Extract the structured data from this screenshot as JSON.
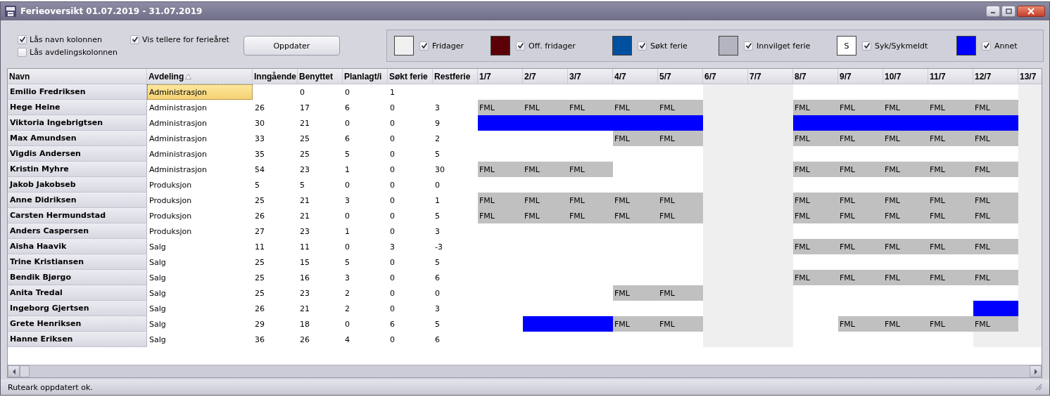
{
  "window": {
    "title": "Ferieoversikt 01.07.2019 - 31.07.2019"
  },
  "options": [
    {
      "label": "Lås navn kolonnen",
      "checked": true
    },
    {
      "label": "Lås avdelingskolonnen",
      "checked": false
    },
    {
      "label": "Vis tellere for ferieåret",
      "checked": true
    }
  ],
  "update_button": "Oppdater",
  "legend": [
    {
      "label": "Fridager",
      "color": "#f0f0f0",
      "checked": true
    },
    {
      "label": "Off. fridager",
      "color": "#5c0008",
      "checked": true
    },
    {
      "label": "Søkt ferie",
      "color": "#0050a0",
      "checked": true
    },
    {
      "label": "Innvilget ferie",
      "color": "#b4b4c0",
      "checked": true
    },
    {
      "label": "Syk/Sykmeldt",
      "color": "#ffffff",
      "swatch_text": "S",
      "checked": true
    },
    {
      "label": "Annet",
      "color": "#0000ff",
      "checked": true
    }
  ],
  "table": {
    "columns": [
      {
        "label": "Navn"
      },
      {
        "label": "Avdeling",
        "sorted": true
      },
      {
        "label": "Inngående"
      },
      {
        "label": "Benyttet"
      },
      {
        "label": "Planlagt/i"
      },
      {
        "label": "Søkt ferie"
      },
      {
        "label": "Restferie"
      }
    ],
    "days": [
      {
        "label": "1/7",
        "weekend": false
      },
      {
        "label": "2/7",
        "weekend": false
      },
      {
        "label": "3/7",
        "weekend": false
      },
      {
        "label": "4/7",
        "weekend": false
      },
      {
        "label": "5/7",
        "weekend": false
      },
      {
        "label": "6/7",
        "weekend": true
      },
      {
        "label": "7/7",
        "weekend": true
      },
      {
        "label": "8/7",
        "weekend": false
      },
      {
        "label": "9/7",
        "weekend": false
      },
      {
        "label": "10/7",
        "weekend": false
      },
      {
        "label": "11/7",
        "weekend": false
      },
      {
        "label": "12/7",
        "weekend": false
      },
      {
        "label": "13/7",
        "weekend": true
      }
    ],
    "rows": [
      {
        "name": "Emilio Fredriksen",
        "department": "Administrasjon",
        "selected": true,
        "used": "0",
        "planned": "0",
        "applied": "1",
        "cells": [
          {
            "kind": "empty"
          },
          {
            "kind": "empty"
          },
          {
            "kind": "empty"
          },
          {
            "kind": "empty"
          },
          {
            "kind": "empty"
          },
          {
            "kind": "empty"
          },
          {
            "kind": "empty"
          },
          {
            "kind": "empty"
          },
          {
            "kind": "empty"
          },
          {
            "kind": "empty"
          },
          {
            "kind": "empty"
          },
          {
            "kind": "empty"
          },
          {
            "kind": "empty"
          }
        ]
      },
      {
        "name": "Hege Heine",
        "department": "Administrasjon",
        "selected": false,
        "incoming": "26",
        "used": "17",
        "planned": "6",
        "applied": "0",
        "remaining": "3",
        "cells": [
          {
            "kind": "fml",
            "text": "FML"
          },
          {
            "kind": "fml",
            "text": "FML"
          },
          {
            "kind": "fml",
            "text": "FML"
          },
          {
            "kind": "fml",
            "text": "FML"
          },
          {
            "kind": "fml",
            "text": "FML"
          },
          {
            "kind": "empty"
          },
          {
            "kind": "empty"
          },
          {
            "kind": "fml",
            "text": "FML"
          },
          {
            "kind": "fml",
            "text": "FML"
          },
          {
            "kind": "fml",
            "text": "FML"
          },
          {
            "kind": "fml",
            "text": "FML"
          },
          {
            "kind": "fml",
            "text": "FML"
          },
          {
            "kind": "empty"
          }
        ]
      },
      {
        "name": "Viktoria Ingebrigtsen",
        "department": "Administrasjon",
        "selected": false,
        "incoming": "30",
        "used": "21",
        "planned": "0",
        "applied": "0",
        "remaining": "9",
        "cells": [
          {
            "kind": "other"
          },
          {
            "kind": "other"
          },
          {
            "kind": "other"
          },
          {
            "kind": "other"
          },
          {
            "kind": "other"
          },
          {
            "kind": "empty"
          },
          {
            "kind": "empty"
          },
          {
            "kind": "other"
          },
          {
            "kind": "other"
          },
          {
            "kind": "other"
          },
          {
            "kind": "other"
          },
          {
            "kind": "other"
          },
          {
            "kind": "empty"
          }
        ]
      },
      {
        "name": "Max Amundsen",
        "department": "Administrasjon",
        "selected": false,
        "incoming": "33",
        "used": "25",
        "planned": "6",
        "applied": "0",
        "remaining": "2",
        "cells": [
          {
            "kind": "empty"
          },
          {
            "kind": "empty"
          },
          {
            "kind": "empty"
          },
          {
            "kind": "fml",
            "text": "FML"
          },
          {
            "kind": "fml",
            "text": "FML"
          },
          {
            "kind": "empty"
          },
          {
            "kind": "empty"
          },
          {
            "kind": "fml",
            "text": "FML"
          },
          {
            "kind": "fml",
            "text": "FML"
          },
          {
            "kind": "fml",
            "text": "FML"
          },
          {
            "kind": "fml",
            "text": "FML"
          },
          {
            "kind": "fml",
            "text": "FML"
          },
          {
            "kind": "empty"
          }
        ]
      },
      {
        "name": "Vigdis Andersen",
        "department": "Administrasjon",
        "selected": false,
        "incoming": "35",
        "used": "25",
        "planned": "5",
        "applied": "0",
        "remaining": "5",
        "cells": [
          {
            "kind": "empty"
          },
          {
            "kind": "empty"
          },
          {
            "kind": "empty"
          },
          {
            "kind": "empty"
          },
          {
            "kind": "empty"
          },
          {
            "kind": "empty"
          },
          {
            "kind": "empty"
          },
          {
            "kind": "empty"
          },
          {
            "kind": "empty"
          },
          {
            "kind": "empty"
          },
          {
            "kind": "empty"
          },
          {
            "kind": "empty"
          },
          {
            "kind": "empty"
          }
        ]
      },
      {
        "name": "Kristin Myhre",
        "department": "Administrasjon",
        "selected": false,
        "incoming": "54",
        "used": "23",
        "planned": "1",
        "applied": "0",
        "remaining": "30",
        "cells": [
          {
            "kind": "fml",
            "text": "FML"
          },
          {
            "kind": "fml",
            "text": "FML"
          },
          {
            "kind": "fml",
            "text": "FML"
          },
          {
            "kind": "empty"
          },
          {
            "kind": "empty"
          },
          {
            "kind": "empty"
          },
          {
            "kind": "empty"
          },
          {
            "kind": "fml",
            "text": "FML"
          },
          {
            "kind": "fml",
            "text": "FML"
          },
          {
            "kind": "fml",
            "text": "FML"
          },
          {
            "kind": "fml",
            "text": "FML"
          },
          {
            "kind": "fml",
            "text": "FML"
          },
          {
            "kind": "empty"
          }
        ]
      },
      {
        "name": "Jakob Jakobseb",
        "department": "Produksjon",
        "selected": false,
        "incoming": "5",
        "used": "5",
        "planned": "0",
        "applied": "0",
        "remaining": "0",
        "cells": [
          {
            "kind": "empty"
          },
          {
            "kind": "empty"
          },
          {
            "kind": "empty"
          },
          {
            "kind": "empty"
          },
          {
            "kind": "empty"
          },
          {
            "kind": "empty"
          },
          {
            "kind": "empty"
          },
          {
            "kind": "empty"
          },
          {
            "kind": "empty"
          },
          {
            "kind": "empty"
          },
          {
            "kind": "empty"
          },
          {
            "kind": "empty"
          },
          {
            "kind": "empty"
          }
        ]
      },
      {
        "name": "Anne Didriksen",
        "department": "Produksjon",
        "selected": false,
        "incoming": "25",
        "used": "21",
        "planned": "3",
        "applied": "0",
        "remaining": "1",
        "cells": [
          {
            "kind": "fml",
            "text": "FML"
          },
          {
            "kind": "fml",
            "text": "FML"
          },
          {
            "kind": "fml",
            "text": "FML"
          },
          {
            "kind": "fml",
            "text": "FML"
          },
          {
            "kind": "fml",
            "text": "FML"
          },
          {
            "kind": "empty"
          },
          {
            "kind": "empty"
          },
          {
            "kind": "fml",
            "text": "FML"
          },
          {
            "kind": "fml",
            "text": "FML"
          },
          {
            "kind": "fml",
            "text": "FML"
          },
          {
            "kind": "fml",
            "text": "FML"
          },
          {
            "kind": "fml",
            "text": "FML"
          },
          {
            "kind": "empty"
          }
        ]
      },
      {
        "name": "Carsten Hermundstad",
        "department": "Produksjon",
        "selected": false,
        "incoming": "26",
        "used": "21",
        "planned": "0",
        "applied": "0",
        "remaining": "5",
        "cells": [
          {
            "kind": "fml",
            "text": "FML"
          },
          {
            "kind": "fml",
            "text": "FML"
          },
          {
            "kind": "fml",
            "text": "FML"
          },
          {
            "kind": "fml",
            "text": "FML"
          },
          {
            "kind": "fml",
            "text": "FML"
          },
          {
            "kind": "empty"
          },
          {
            "kind": "empty"
          },
          {
            "kind": "fml",
            "text": "FML"
          },
          {
            "kind": "fml",
            "text": "FML"
          },
          {
            "kind": "fml",
            "text": "FML"
          },
          {
            "kind": "fml",
            "text": "FML"
          },
          {
            "kind": "fml",
            "text": "FML"
          },
          {
            "kind": "empty"
          }
        ]
      },
      {
        "name": "Anders Caspersen",
        "department": "Produksjon",
        "selected": false,
        "incoming": "27",
        "used": "23",
        "planned": "1",
        "applied": "0",
        "remaining": "3",
        "cells": [
          {
            "kind": "empty"
          },
          {
            "kind": "empty"
          },
          {
            "kind": "empty"
          },
          {
            "kind": "empty"
          },
          {
            "kind": "empty"
          },
          {
            "kind": "empty"
          },
          {
            "kind": "empty"
          },
          {
            "kind": "empty"
          },
          {
            "kind": "empty"
          },
          {
            "kind": "empty"
          },
          {
            "kind": "empty"
          },
          {
            "kind": "empty"
          },
          {
            "kind": "empty"
          }
        ]
      },
      {
        "name": "Aisha Haavik",
        "department": "Salg",
        "selected": false,
        "incoming": "11",
        "used": "11",
        "planned": "0",
        "applied": "3",
        "remaining": "-3",
        "cells": [
          {
            "kind": "empty"
          },
          {
            "kind": "empty"
          },
          {
            "kind": "empty"
          },
          {
            "kind": "empty"
          },
          {
            "kind": "empty"
          },
          {
            "kind": "empty"
          },
          {
            "kind": "empty"
          },
          {
            "kind": "fml",
            "text": "FML"
          },
          {
            "kind": "fml",
            "text": "FML"
          },
          {
            "kind": "fml",
            "text": "FML"
          },
          {
            "kind": "fml",
            "text": "FML"
          },
          {
            "kind": "fml",
            "text": "FML"
          },
          {
            "kind": "empty"
          }
        ]
      },
      {
        "name": "Trine Kristiansen",
        "department": "Salg",
        "selected": false,
        "incoming": "25",
        "used": "15",
        "planned": "5",
        "applied": "0",
        "remaining": "5",
        "cells": [
          {
            "kind": "empty"
          },
          {
            "kind": "empty"
          },
          {
            "kind": "empty"
          },
          {
            "kind": "empty"
          },
          {
            "kind": "empty"
          },
          {
            "kind": "empty"
          },
          {
            "kind": "empty"
          },
          {
            "kind": "empty"
          },
          {
            "kind": "empty"
          },
          {
            "kind": "empty"
          },
          {
            "kind": "empty"
          },
          {
            "kind": "empty"
          },
          {
            "kind": "empty"
          }
        ]
      },
      {
        "name": "Bendik Bjørgo",
        "department": "Salg",
        "selected": false,
        "incoming": "25",
        "used": "16",
        "planned": "3",
        "applied": "0",
        "remaining": "6",
        "cells": [
          {
            "kind": "empty"
          },
          {
            "kind": "empty"
          },
          {
            "kind": "empty"
          },
          {
            "kind": "empty"
          },
          {
            "kind": "empty"
          },
          {
            "kind": "empty"
          },
          {
            "kind": "empty"
          },
          {
            "kind": "fml",
            "text": "FML"
          },
          {
            "kind": "fml",
            "text": "FML"
          },
          {
            "kind": "fml",
            "text": "FML"
          },
          {
            "kind": "fml",
            "text": "FML"
          },
          {
            "kind": "fml",
            "text": "FML"
          },
          {
            "kind": "empty"
          }
        ]
      },
      {
        "name": "Anita Tredal",
        "department": "Salg",
        "selected": false,
        "incoming": "25",
        "used": "23",
        "planned": "2",
        "applied": "0",
        "remaining": "0",
        "cells": [
          {
            "kind": "empty"
          },
          {
            "kind": "empty"
          },
          {
            "kind": "empty"
          },
          {
            "kind": "fml",
            "text": "FML"
          },
          {
            "kind": "fml",
            "text": "FML"
          },
          {
            "kind": "empty"
          },
          {
            "kind": "empty"
          },
          {
            "kind": "empty"
          },
          {
            "kind": "empty"
          },
          {
            "kind": "empty"
          },
          {
            "kind": "empty"
          },
          {
            "kind": "empty"
          },
          {
            "kind": "empty"
          }
        ]
      },
      {
        "name": "Ingeborg Gjertsen",
        "department": "Salg",
        "selected": false,
        "incoming": "26",
        "used": "21",
        "planned": "2",
        "applied": "0",
        "remaining": "3",
        "cells": [
          {
            "kind": "empty"
          },
          {
            "kind": "empty"
          },
          {
            "kind": "empty"
          },
          {
            "kind": "empty"
          },
          {
            "kind": "empty"
          },
          {
            "kind": "empty"
          },
          {
            "kind": "empty"
          },
          {
            "kind": "empty"
          },
          {
            "kind": "empty"
          },
          {
            "kind": "empty"
          },
          {
            "kind": "empty"
          },
          {
            "kind": "other"
          },
          {
            "kind": "empty"
          }
        ]
      },
      {
        "name": "Grete Henriksen",
        "department": "Salg",
        "selected": false,
        "incoming": "29",
        "used": "18",
        "planned": "0",
        "applied": "6",
        "remaining": "5",
        "cells": [
          {
            "kind": "empty"
          },
          {
            "kind": "other"
          },
          {
            "kind": "other"
          },
          {
            "kind": "fml",
            "text": "FML"
          },
          {
            "kind": "fml",
            "text": "FML"
          },
          {
            "kind": "empty"
          },
          {
            "kind": "empty"
          },
          {
            "kind": "empty"
          },
          {
            "kind": "fml",
            "text": "FML"
          },
          {
            "kind": "fml",
            "text": "FML"
          },
          {
            "kind": "fml",
            "text": "FML"
          },
          {
            "kind": "fml",
            "text": "FML"
          },
          {
            "kind": "empty"
          }
        ]
      },
      {
        "name": "Hanne Eriksen",
        "department": "Salg",
        "selected": false,
        "incoming": "36",
        "used": "26",
        "planned": "4",
        "applied": "0",
        "remaining": "6",
        "cells": [
          {
            "kind": "empty"
          },
          {
            "kind": "empty"
          },
          {
            "kind": "empty"
          },
          {
            "kind": "empty"
          },
          {
            "kind": "empty"
          },
          {
            "kind": "empty"
          },
          {
            "kind": "empty"
          },
          {
            "kind": "empty"
          },
          {
            "kind": "empty"
          },
          {
            "kind": "empty"
          },
          {
            "kind": "empty"
          },
          {
            "kind": "dayoff"
          },
          {
            "kind": "empty"
          }
        ]
      }
    ]
  },
  "status_bar": "Ruteark oppdatert ok."
}
